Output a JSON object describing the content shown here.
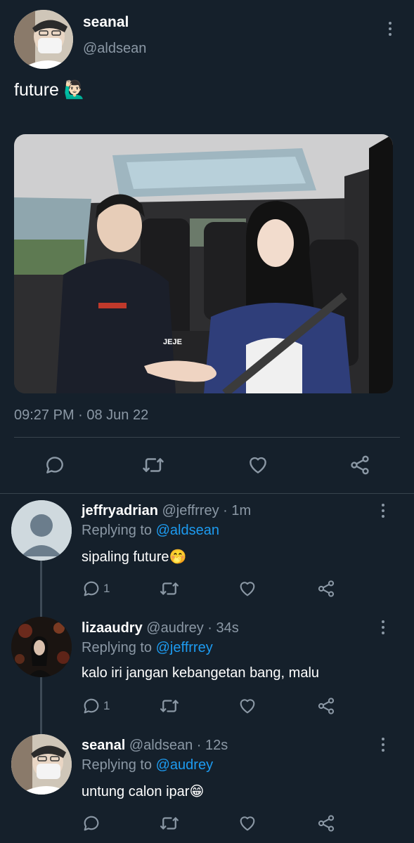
{
  "tweet": {
    "display_name": "seanal",
    "handle": "@aldsean",
    "text": "future 🙋🏻‍♂️",
    "image_watermark": "JEJE",
    "timestamp": "09:27 PM · 08 Jun 22"
  },
  "replies": [
    {
      "display_name": "jeffryadrian",
      "handle_time": "@jeffrrey · 1m",
      "replying_prefix": "Replying to ",
      "replying_to": "@aldsean",
      "text": "sipaling future🤭",
      "reply_count": "1",
      "avatar": "default-avatar"
    },
    {
      "display_name": "lizaaudry",
      "handle_time": "@audrey · 34s",
      "replying_prefix": "Replying to ",
      "replying_to": "@jeffrrey",
      "text": "kalo iri jangan kebangetan bang, malu",
      "reply_count": "1",
      "avatar": "photo-avatar"
    },
    {
      "display_name": "seanal",
      "handle_time": "@aldsean · 12s",
      "replying_prefix": "Replying to ",
      "replying_to": "@audrey",
      "text": "untung calon ipar😁",
      "reply_count": "",
      "avatar": "photo-avatar"
    }
  ],
  "icons": [
    "more-vertical-icon",
    "reply-icon",
    "retweet-icon",
    "like-icon",
    "share-icon"
  ],
  "colors": {
    "background": "#15202b",
    "muted": "#8b98a5",
    "link": "#1d9bf0",
    "divider": "#38444d"
  }
}
